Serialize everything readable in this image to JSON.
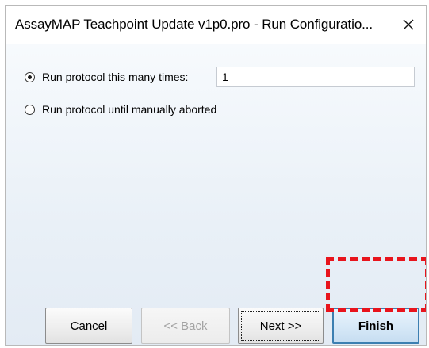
{
  "window": {
    "title": "AssayMAP Teachpoint Update v1p0.pro - Run Configuratio...",
    "close_icon": "close-icon"
  },
  "options": {
    "run_times": {
      "label": "Run protocol this many times:",
      "selected": true,
      "value": "1"
    },
    "run_until_aborted": {
      "label": "Run protocol until manually aborted",
      "selected": false
    }
  },
  "buttons": {
    "cancel": "Cancel",
    "back": "<< Back",
    "next": "Next >>",
    "finish": "Finish"
  },
  "colors": {
    "highlight": "#e8141c",
    "default_button_border": "#3c7fb1"
  }
}
